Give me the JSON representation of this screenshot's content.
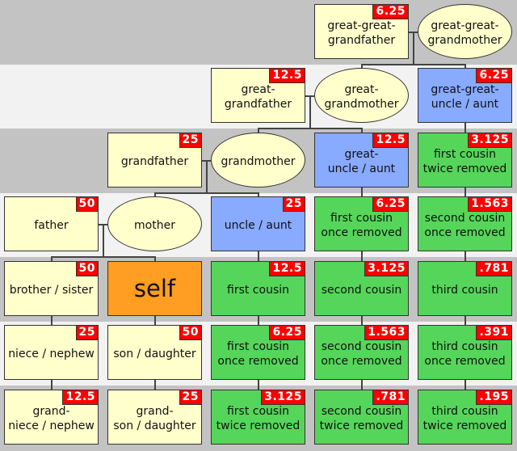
{
  "colors": {
    "band_dark": "#c3c3c3",
    "band_light": "#f2f2f2",
    "ancestor": "#ffffcc",
    "descendant": "#ffffcc",
    "self": "#ff9e22",
    "uncle": "#88aaff",
    "cousin": "#55d65a",
    "badge": "#ff0000"
  },
  "rows": [
    [
      null,
      null,
      null,
      {
        "label": "great-great-\ngrandfather",
        "badge": "6.25",
        "kind": "ancestor",
        "shape": "box"
      },
      {
        "label": "great-great-\ngrandmother",
        "kind": "ancestor",
        "shape": "ellipse"
      }
    ],
    [
      null,
      null,
      {
        "label": "great-\ngrandfather",
        "badge": "12.5",
        "kind": "ancestor",
        "shape": "box"
      },
      {
        "label": "great-\ngrandmother",
        "kind": "ancestor",
        "shape": "ellipse"
      },
      {
        "label": "great-great-\nuncle / aunt",
        "badge": "6.25",
        "kind": "uncle",
        "shape": "box"
      }
    ],
    [
      null,
      {
        "label": "grandfather",
        "badge": "25",
        "kind": "ancestor",
        "shape": "box"
      },
      {
        "label": "grandmother",
        "kind": "ancestor",
        "shape": "ellipse"
      },
      {
        "label": "great-\nuncle / aunt",
        "badge": "12.5",
        "kind": "uncle",
        "shape": "box"
      },
      {
        "label": "first cousin\ntwice removed",
        "badge": "3.125",
        "kind": "cousin",
        "shape": "box"
      }
    ],
    [
      {
        "label": "father",
        "badge": "50",
        "kind": "ancestor",
        "shape": "box"
      },
      {
        "label": "mother",
        "kind": "ancestor",
        "shape": "ellipse"
      },
      {
        "label": "uncle / aunt",
        "badge": "25",
        "kind": "uncle",
        "shape": "box"
      },
      {
        "label": "first cousin\nonce removed",
        "badge": "6.25",
        "kind": "cousin",
        "shape": "box"
      },
      {
        "label": "second cousin\nonce removed",
        "badge": "1.563",
        "kind": "cousin",
        "shape": "box"
      }
    ],
    [
      {
        "label": "brother / sister",
        "badge": "50",
        "kind": "descendant",
        "shape": "box"
      },
      {
        "label": "self",
        "kind": "self",
        "shape": "box"
      },
      {
        "label": "first cousin",
        "badge": "12.5",
        "kind": "cousin",
        "shape": "box"
      },
      {
        "label": "second cousin",
        "badge": "3.125",
        "kind": "cousin",
        "shape": "box"
      },
      {
        "label": "third cousin",
        "badge": ".781",
        "kind": "cousin",
        "shape": "box"
      }
    ],
    [
      {
        "label": "niece / nephew",
        "badge": "25",
        "kind": "descendant",
        "shape": "box"
      },
      {
        "label": "son / daughter",
        "badge": "50",
        "kind": "descendant",
        "shape": "box"
      },
      {
        "label": "first cousin\nonce removed",
        "badge": "6.25",
        "kind": "cousin",
        "shape": "box"
      },
      {
        "label": "second cousin\nonce removed",
        "badge": "1.563",
        "kind": "cousin",
        "shape": "box"
      },
      {
        "label": "third cousin\nonce removed",
        "badge": ".391",
        "kind": "cousin",
        "shape": "box"
      }
    ],
    [
      {
        "label": "grand-\nniece / nephew",
        "badge": "12.5",
        "kind": "descendant",
        "shape": "box"
      },
      {
        "label": "grand-\nson / daughter",
        "badge": "25",
        "kind": "descendant",
        "shape": "box"
      },
      {
        "label": "first cousin\ntwice removed",
        "badge": "3.125",
        "kind": "cousin",
        "shape": "box"
      },
      {
        "label": "second cousin\ntwice removed",
        "badge": ".781",
        "kind": "cousin",
        "shape": "box"
      },
      {
        "label": "third cousin\ntwice removed",
        "badge": ".195",
        "kind": "cousin",
        "shape": "box"
      }
    ]
  ]
}
